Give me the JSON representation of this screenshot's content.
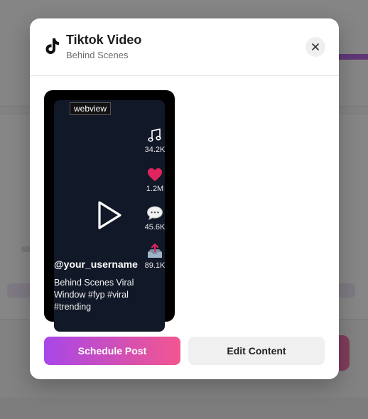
{
  "modal": {
    "title": "Tiktok Video",
    "subtitle": "Behind Scenes",
    "brand_icon": "tiktok-logo-icon",
    "close_icon": "close-icon"
  },
  "preview": {
    "tag": "webview",
    "play_icon": "play-icon",
    "actions": [
      {
        "icon": "music-note-icon",
        "count": "34.2K"
      },
      {
        "icon": "heart-icon",
        "count": "1.2M"
      },
      {
        "icon": "comment-icon",
        "count": "45.6K"
      },
      {
        "icon": "share-inbox-icon",
        "count": "89.1K"
      }
    ],
    "username": "@your_username",
    "caption": "Behind Scenes Viral Window #fyp #viral #trending"
  },
  "buttons": {
    "primary": "Schedule Post",
    "secondary": "Edit Content"
  },
  "colors": {
    "gradient_start": "#a847e8",
    "gradient_end": "#f2568f",
    "screen_bg": "#111827",
    "heart": "#e0245e"
  }
}
